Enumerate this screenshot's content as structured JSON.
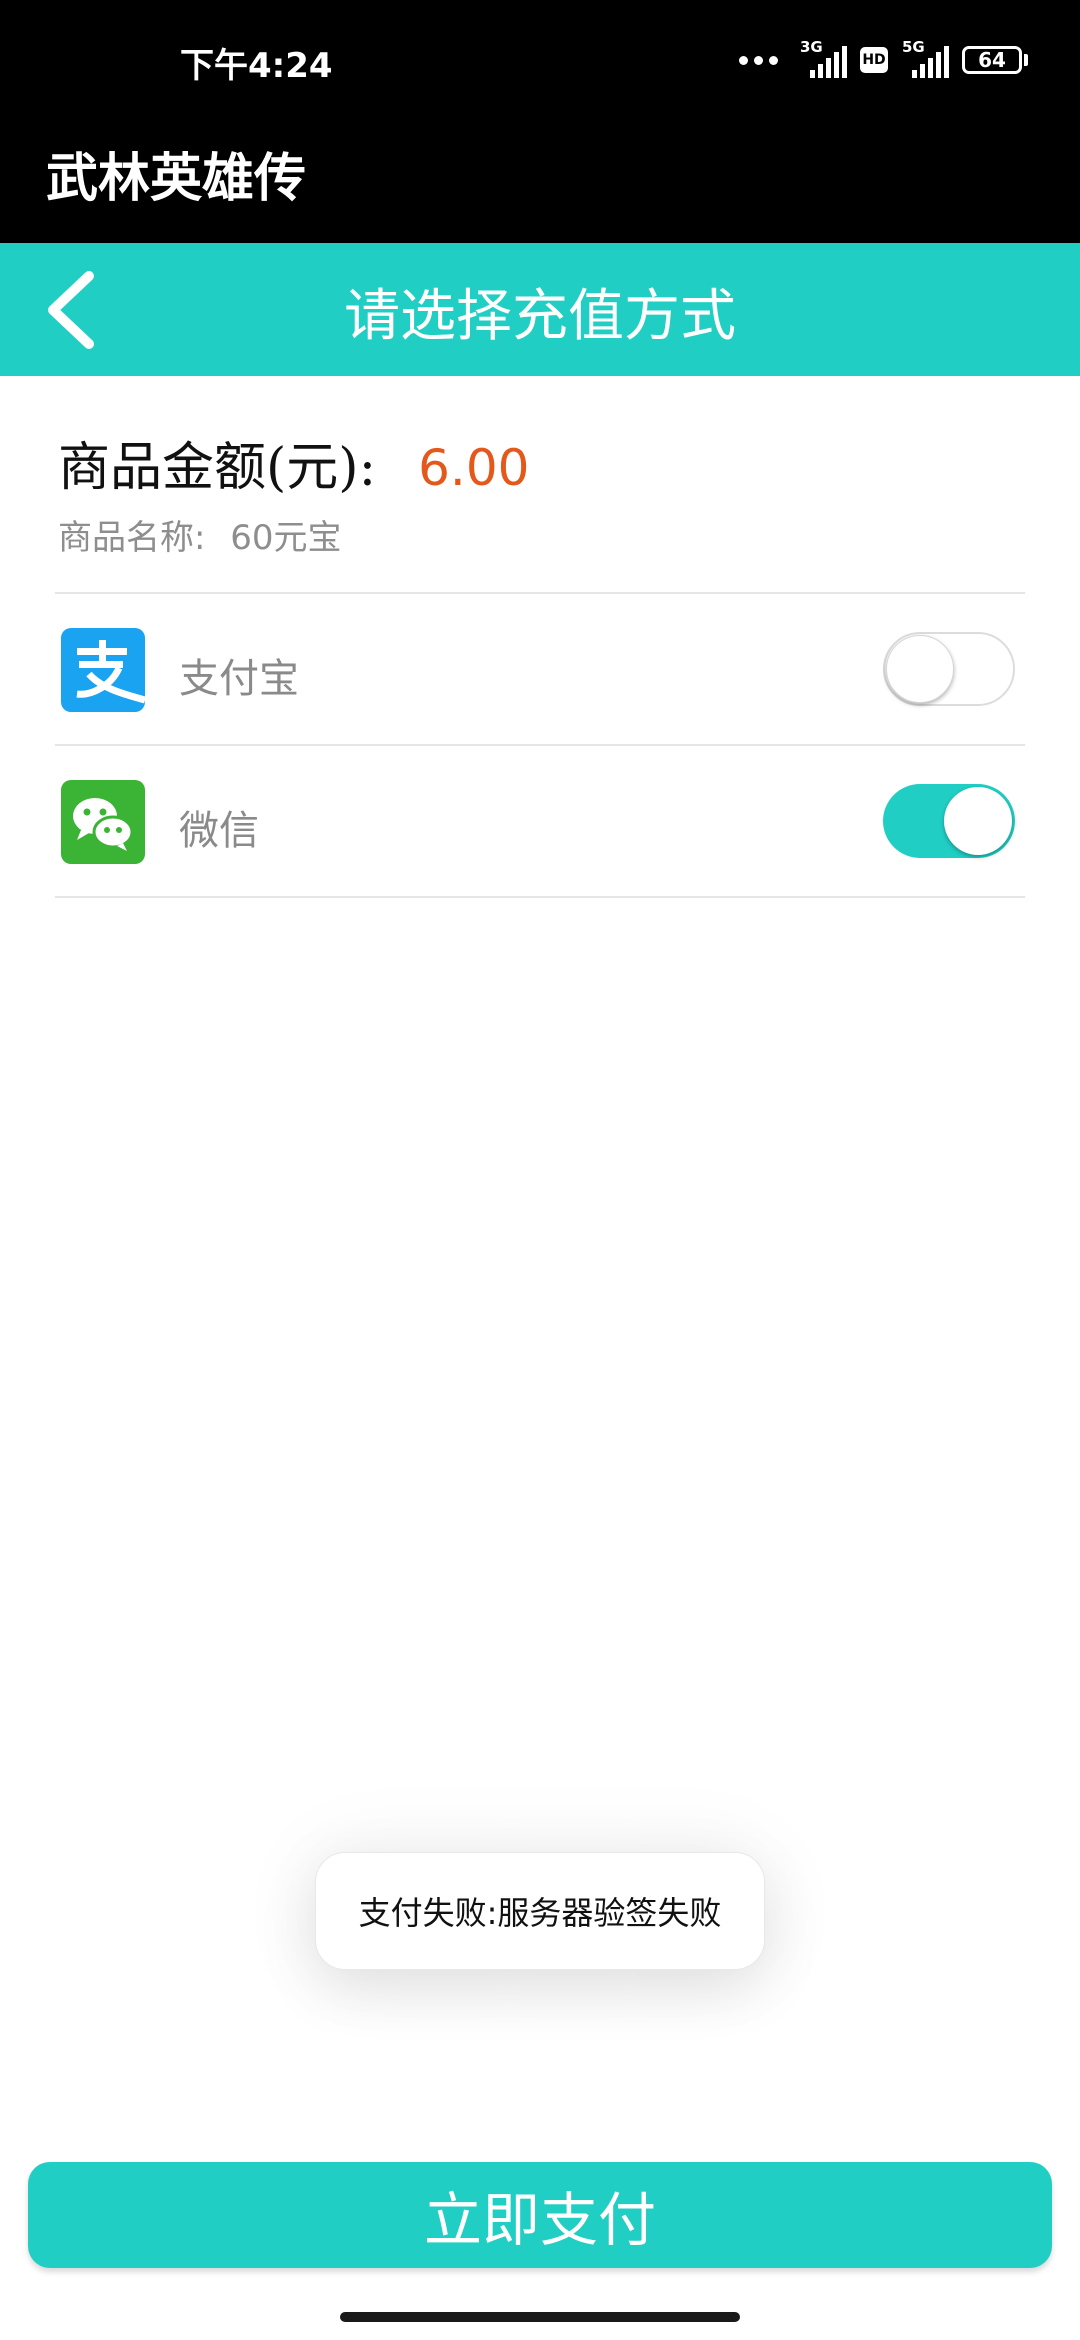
{
  "status_bar": {
    "time": "下午4:24",
    "network1": "3G",
    "hd": "HD",
    "network2": "5G",
    "battery": "64"
  },
  "app": {
    "title": "武林英雄传"
  },
  "header": {
    "title": "请选择充值方式",
    "back_icon": "chevron-left-icon"
  },
  "product": {
    "amount_label": "商品金额(元):",
    "amount_value": "6.00",
    "name_label": "商品名称:",
    "name_value": "60元宝"
  },
  "payment_methods": [
    {
      "label": "支付宝",
      "icon": "alipay-icon",
      "selected": false
    },
    {
      "label": "微信",
      "icon": "wechat-icon",
      "selected": true
    }
  ],
  "toast": {
    "message": "支付失败:服务器验签失败"
  },
  "pay_button": {
    "label": "立即支付"
  },
  "colors": {
    "accent": "#20cec4",
    "amount": "#e4581c",
    "alipay": "#1aa3f0",
    "wechat": "#3bb334"
  }
}
